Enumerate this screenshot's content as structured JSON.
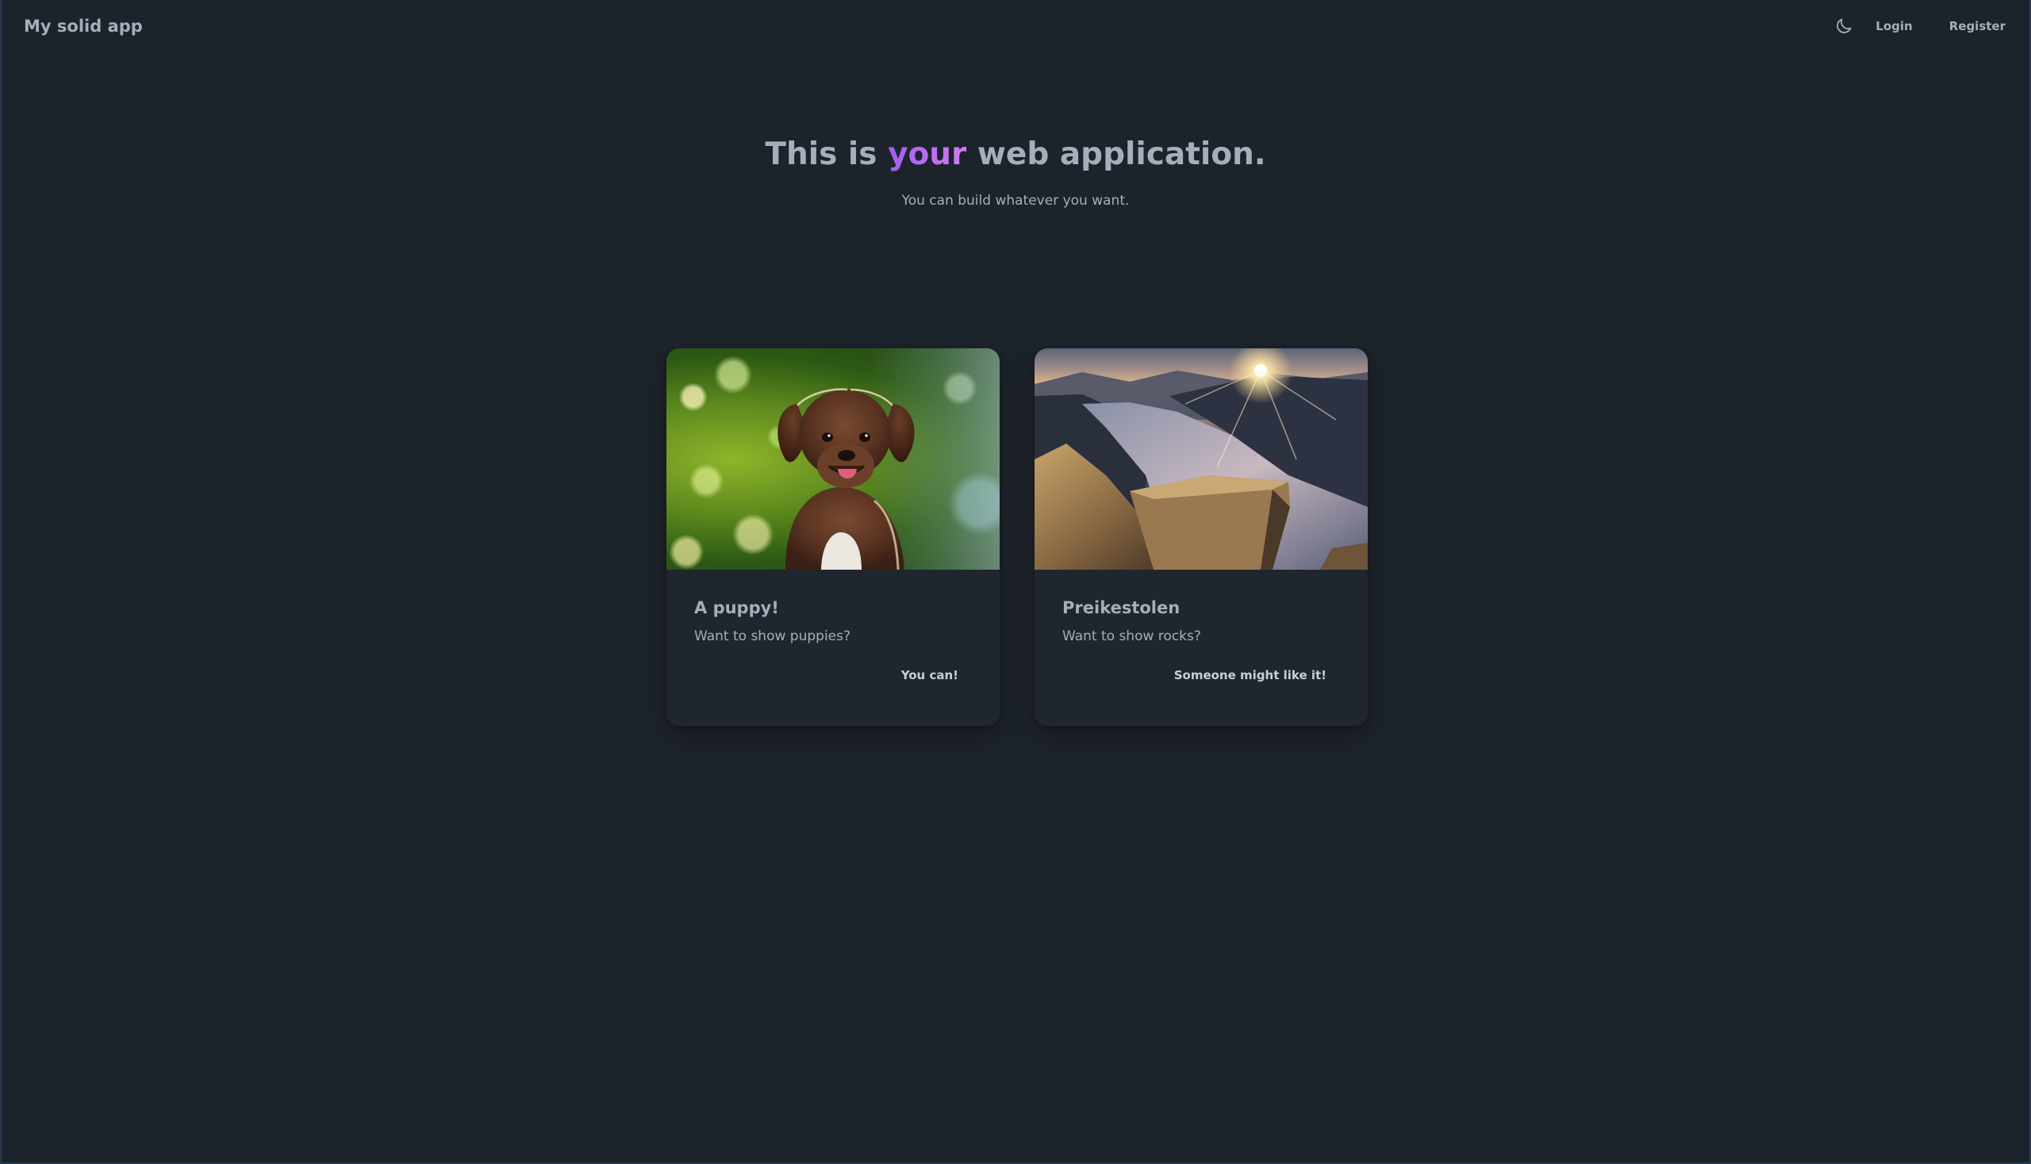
{
  "navbar": {
    "brand": "My solid app",
    "theme_toggle_icon": "moon-icon",
    "login_label": "Login",
    "register_label": "Register"
  },
  "hero": {
    "title_before": "This is ",
    "title_accent": "your",
    "title_after": " web application.",
    "subtitle": "You can build whatever you want."
  },
  "cards": [
    {
      "image_icon": "puppy-photo",
      "title": "A puppy!",
      "text": "Want to show puppies?",
      "action_label": "You can!"
    },
    {
      "image_icon": "cliff-fjord-photo",
      "title": "Preikestolen",
      "text": "Want to show rocks?",
      "action_label": "Someone might like it!"
    }
  ],
  "colors": {
    "background": "#1d232a",
    "card": "#1f262e",
    "text": "#a6adbb",
    "accent": "#b370f0"
  }
}
